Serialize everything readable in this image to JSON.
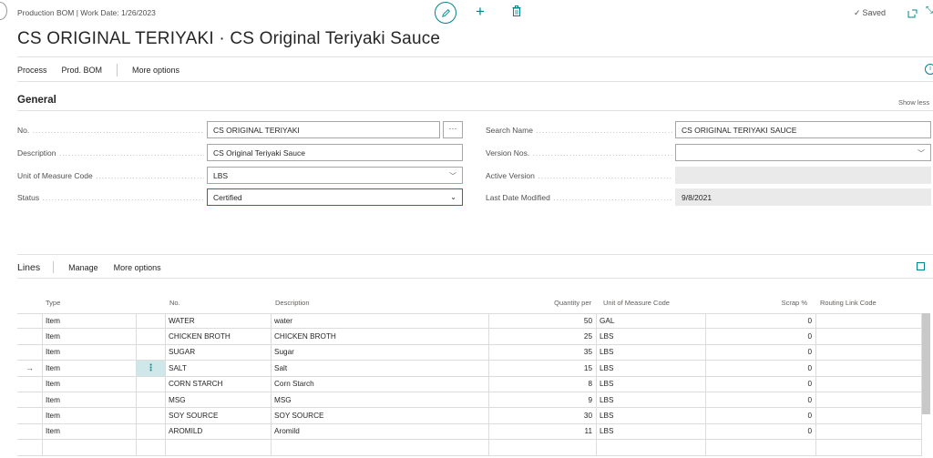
{
  "header": {
    "breadcrumb": "Production BOM | Work Date: 1/26/2023",
    "saved_label": "Saved",
    "title": "CS ORIGINAL TERIYAKI · CS Original Teriyaki Sauce",
    "accent_color": "#008489"
  },
  "actions": {
    "process": "Process",
    "prod_bom": "Prod. BOM",
    "more_options": "More options"
  },
  "general": {
    "title": "General",
    "show_less": "Show less",
    "fields": {
      "no_label": "No.",
      "no_value": "CS ORIGINAL TERIYAKI",
      "description_label": "Description",
      "description_value": "CS Original Teriyaki Sauce",
      "uom_label": "Unit of Measure Code",
      "uom_value": "LBS",
      "status_label": "Status",
      "status_value": "Certified",
      "search_name_label": "Search Name",
      "search_name_value": "CS ORIGINAL TERIYAKI SAUCE",
      "version_nos_label": "Version Nos.",
      "version_nos_value": "",
      "active_version_label": "Active Version",
      "active_version_value": "",
      "last_modified_label": "Last Date Modified",
      "last_modified_value": "9/8/2021"
    }
  },
  "lines": {
    "title": "Lines",
    "manage": "Manage",
    "more_options": "More options",
    "columns": {
      "type": "Type",
      "no": "No.",
      "description": "Description",
      "quantity_per": "Quantity per",
      "uom": "Unit of Measure Code",
      "scrap": "Scrap %",
      "routing": "Routing Link Code"
    },
    "rows": [
      {
        "type": "Item",
        "no": "WATER",
        "description": "water",
        "qty": "50",
        "uom": "GAL",
        "scrap": "0",
        "routing": ""
      },
      {
        "type": "Item",
        "no": "CHICKEN BROTH",
        "description": "CHICKEN BROTH",
        "qty": "25",
        "uom": "LBS",
        "scrap": "0",
        "routing": ""
      },
      {
        "type": "Item",
        "no": "SUGAR",
        "description": "Sugar",
        "qty": "35",
        "uom": "LBS",
        "scrap": "0",
        "routing": ""
      },
      {
        "type": "Item",
        "no": "SALT",
        "description": "Salt",
        "qty": "15",
        "uom": "LBS",
        "scrap": "0",
        "routing": ""
      },
      {
        "type": "Item",
        "no": "CORN STARCH",
        "description": "Corn Starch",
        "qty": "8",
        "uom": "LBS",
        "scrap": "0",
        "routing": ""
      },
      {
        "type": "Item",
        "no": "MSG",
        "description": "MSG",
        "qty": "9",
        "uom": "LBS",
        "scrap": "0",
        "routing": ""
      },
      {
        "type": "Item",
        "no": "SOY SOURCE",
        "description": "SOY SOURCE",
        "qty": "30",
        "uom": "LBS",
        "scrap": "0",
        "routing": ""
      },
      {
        "type": "Item",
        "no": "AROMILD",
        "description": "Aromild",
        "qty": "11",
        "uom": "LBS",
        "scrap": "0",
        "routing": ""
      },
      {
        "type": "",
        "no": "",
        "description": "",
        "qty": "",
        "uom": "",
        "scrap": "",
        "routing": ""
      }
    ],
    "selected_row": 3
  }
}
